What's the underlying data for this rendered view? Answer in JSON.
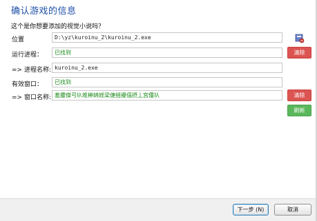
{
  "dialog": {
    "title": "确认游戏的信息",
    "subtitle": "这个是你想要添加的视觉小说吗？"
  },
  "rows": {
    "location": {
      "label": "位置",
      "value": "D:\\yz\\kuroinu_2\\kuroinu_2.exe"
    },
    "running_process": {
      "label": "运行进程：",
      "value": "已找到",
      "clear_label": "清除"
    },
    "process_name": {
      "label": "=> 进程名称:",
      "value": "kuroinu_2.exe"
    },
    "valid_window": {
      "label": "有效窗口：",
      "value": "已找到"
    },
    "window_name": {
      "label": "=> 窗口名称:",
      "value": "羞膿傑弓圦堆榊婂婬梁倢揺擾偪摂丄宮偅圦",
      "clear_label": "清除",
      "refresh_label": "刷新"
    }
  },
  "icons": {
    "browse": "browse-folder-icon"
  },
  "footer": {
    "next_label": "下一步 (N)",
    "cancel_label": "取消"
  },
  "colors": {
    "title": "#1e4ea8",
    "found_text": "#1a8a1a",
    "clear_button": "#dc5451",
    "refresh_button": "#5bb75b"
  }
}
